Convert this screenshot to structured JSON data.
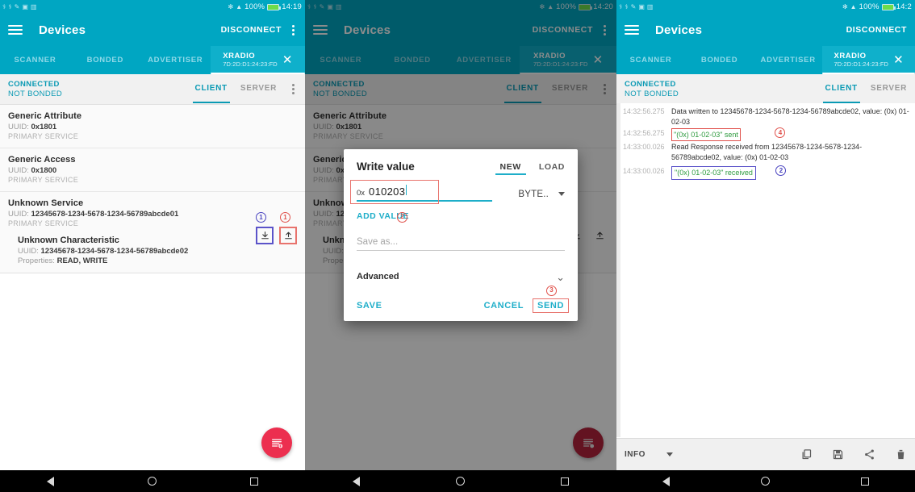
{
  "app": {
    "title": "Devices",
    "disconnect_label": "DISCONNECT",
    "menu_icon": "kebab-menu-icon",
    "drawer_icon": "hamburger-icon"
  },
  "status_bar": {
    "battery": "100%",
    "time_panel1": "14:19",
    "time_panel2": "14:20",
    "time_panel3": "14:2",
    "bluetooth_icon": "bluetooth-icon",
    "wifi_icon": "wifi-icon"
  },
  "tabs": {
    "scanner": "SCANNER",
    "bonded": "BONDED",
    "advertiser": "ADVERTISER",
    "device_name": "XRADIO",
    "device_address": "7D:2D:D1:24:23:FD",
    "close_icon": "close-icon"
  },
  "connection": {
    "state": "CONNECTED",
    "bond_state": "NOT BONDED",
    "client_tab": "CLIENT",
    "server_tab": "SERVER"
  },
  "services": [
    {
      "name": "Generic Attribute",
      "uuid_label": "UUID:",
      "uuid": "0x1801",
      "type": "PRIMARY SERVICE"
    },
    {
      "name": "Generic Access",
      "uuid_label": "UUID:",
      "uuid": "0x1800",
      "type": "PRIMARY SERVICE"
    },
    {
      "name": "Unknown Service",
      "uuid_label": "UUID:",
      "uuid": "12345678-1234-5678-1234-56789abcde01",
      "type": "PRIMARY SERVICE"
    }
  ],
  "characteristic": {
    "name": "Unknown Characteristic",
    "uuid_label": "UUID:",
    "uuid": "12345678-1234-5678-1234-56789abcde02",
    "properties_label": "Properties:",
    "properties": "READ, WRITE",
    "read_icon": "download-arrow-icon",
    "write_icon": "upload-arrow-icon"
  },
  "annotations": {
    "read_marker": "1",
    "write_marker": "1",
    "value_marker": "2",
    "send_marker": "3",
    "sent_log_marker": "4",
    "received_log_marker": "2"
  },
  "dialog": {
    "title": "Write value",
    "tab_new": "NEW",
    "tab_load": "LOAD",
    "hex_prefix": "0x",
    "hex_value": "010203",
    "unit": "BYTE..",
    "unit_caret_icon": "chevron-down-icon",
    "add_value": "ADD VALUE",
    "save_as_placeholder": "Save as...",
    "advanced": "Advanced",
    "advanced_chevron_icon": "chevron-down-icon",
    "save": "SAVE",
    "cancel": "CANCEL",
    "send": "SEND"
  },
  "log": {
    "entries": [
      {
        "time": "14:32:56.275",
        "text": "Data written to 12345678-1234-5678-1234-56789abcde02, value: (0x) 01-02-03",
        "style": "plain"
      },
      {
        "time": "14:32:56.275",
        "text": "\"(0x) 01-02-03\" sent",
        "style": "green-boxed-red"
      },
      {
        "time": "14:33:00.026",
        "text": "Read Response received from 12345678-1234-5678-1234-56789abcde02, value: (0x) 01-02-03",
        "style": "plain"
      },
      {
        "time": "14:33:00.026",
        "text": "\"(0x) 01-02-03\" received",
        "style": "green-boxed-blue"
      }
    ],
    "level_filter": "INFO",
    "level_caret_icon": "chevron-down-icon",
    "copy_icon": "copy-icon",
    "save_icon": "save-disk-icon",
    "share_icon": "share-icon",
    "delete_icon": "trash-icon"
  },
  "fab": {
    "icon": "add-to-list-icon"
  },
  "navbar": {
    "back_icon": "triangle-back-icon",
    "home_icon": "circle-home-icon",
    "recents_icon": "square-recents-icon"
  },
  "colors": {
    "teal": "#00a6c2",
    "teal_dark": "#0a9ab4",
    "accent_blue": "#1eaec9",
    "fab_red": "#ec2f4f",
    "anno_red": "#e0514b",
    "anno_blue": "#4a44c0",
    "log_green": "#2e9b3f"
  }
}
